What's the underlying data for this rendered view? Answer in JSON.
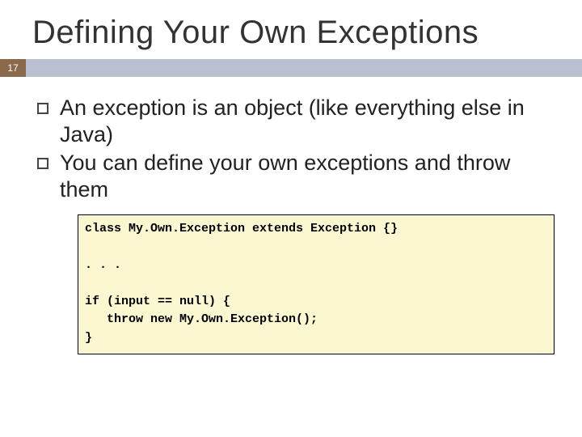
{
  "slide": {
    "title": "Defining Your Own Exceptions",
    "pageNumber": "17",
    "bullets": [
      "An exception is an object (like everything else in Java)",
      "You can define your own exceptions and throw them"
    ],
    "code": "class My.Own.Exception extends Exception {}\n\n. . .\n\nif (input == null) {\n   throw new My.Own.Exception();\n}"
  }
}
